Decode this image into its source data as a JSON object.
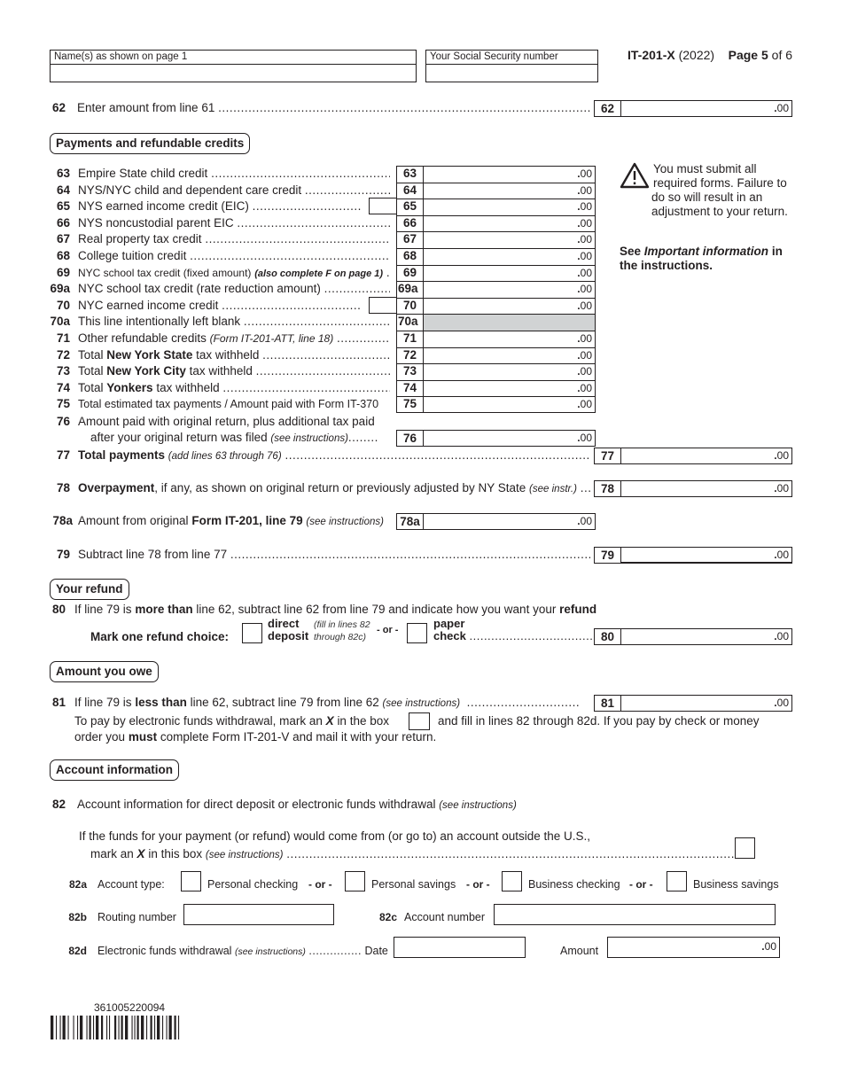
{
  "header": {
    "name_label": "Name(s) as shown on page 1",
    "name_value": "",
    "ssn_label": "Your Social Security number",
    "ssn_value": "",
    "form_id": "IT-201-X",
    "form_year": "(2022)",
    "page_word": "Page",
    "page_num": "5",
    "page_of": "of 6"
  },
  "cents": ".00",
  "line62": {
    "num": "62",
    "text": "Enter amount from line 61",
    "value": ""
  },
  "sections": {
    "payments": "Payments and refundable credits",
    "refund": "Your refund",
    "owe": "Amount you owe",
    "account": "Account information"
  },
  "credits": [
    {
      "num": "63",
      "text": "Empire State child credit",
      "value": "",
      "has_side_box": false,
      "shaded": false
    },
    {
      "num": "64",
      "text": "NYS/NYC child and dependent care credit",
      "value": "",
      "has_side_box": false,
      "shaded": false
    },
    {
      "num": "65",
      "text": "NYS earned income credit (EIC)",
      "value": "",
      "has_side_box": true,
      "shaded": false
    },
    {
      "num": "66",
      "text": "NYS noncustodial parent EIC",
      "value": "",
      "has_side_box": false,
      "shaded": false
    },
    {
      "num": "67",
      "text": "Real property tax credit",
      "value": "",
      "has_side_box": false,
      "shaded": false
    },
    {
      "num": "68",
      "text": "College tuition credit",
      "value": "",
      "has_side_box": false,
      "shaded": false
    },
    {
      "num": "69",
      "text": "NYC school tax credit (fixed amount)",
      "note": "(also complete F on page 1)",
      "value": "",
      "has_side_box": false,
      "shaded": false
    },
    {
      "num": "69a",
      "text": "NYC school tax credit (rate reduction amount)",
      "value": "",
      "has_side_box": false,
      "shaded": false
    },
    {
      "num": "70",
      "text": "NYC earned income credit",
      "value": "",
      "has_side_box": true,
      "shaded": false
    },
    {
      "num": "70a",
      "text": "This line intentionally left blank",
      "value": "",
      "has_side_box": false,
      "shaded": true
    },
    {
      "num": "71",
      "text": "Other refundable credits",
      "note": "(Form IT-201-ATT, line 18)",
      "value": "",
      "has_side_box": false,
      "shaded": false
    },
    {
      "num": "72",
      "text_pre": "Total",
      "text_bold": "New York State",
      "text_post": "tax withheld",
      "value": "",
      "shaded": false
    },
    {
      "num": "73",
      "text_pre": "Total",
      "text_bold": "New York City",
      "text_post": "tax withheld",
      "value": "",
      "shaded": false
    },
    {
      "num": "74",
      "text_pre": "Total",
      "text_bold": "Yonkers",
      "text_post": "tax withheld",
      "value": "",
      "shaded": false
    },
    {
      "num": "75",
      "text": "Total estimated tax payments / Amount paid with Form IT-370",
      "value": "",
      "shaded": false
    }
  ],
  "line76": {
    "num": "76",
    "text1": "Amount paid with original return, plus additional tax paid",
    "text2": "after your original return was filed",
    "note": "(see instructions)",
    "value": ""
  },
  "line77": {
    "num": "77",
    "bold": "Total payments",
    "note": "(add lines 63 through 76)",
    "value": ""
  },
  "line78": {
    "num": "78",
    "bold": "Overpayment",
    "text": ", if any, as shown on original return or previously adjusted by NY State",
    "note": "(see instr.)",
    "value": ""
  },
  "line78a": {
    "num": "78a",
    "text": "Amount from original",
    "bold": "Form IT-201, line 79",
    "note": "(see instructions)",
    "value": ""
  },
  "line79": {
    "num": "79",
    "text": "Subtract line 78 from line 77",
    "value": ""
  },
  "line80": {
    "num": "80",
    "t1": "If line 79 is",
    "b1": "more than",
    "t2": "line 62, subtract line 62 from line 79 and indicate how you want your",
    "b2": "refund",
    "choice_label": "Mark one refund choice:",
    "direct_1": "direct",
    "direct_2": "deposit",
    "direct_note_1": "(fill in lines 82",
    "direct_note_2": "through 82c)",
    "or": "- or -",
    "paper_1": "paper",
    "paper_2": "check",
    "direct_checked": false,
    "paper_checked": false,
    "value": ""
  },
  "line81": {
    "num": "81",
    "t1": "If line 79 is",
    "b1": "less than",
    "t2": "line 62, subtract line 79 from line 62",
    "note": "(see instructions)",
    "value": "",
    "efw_t1": "To pay by electronic funds withdrawal, mark an",
    "efw_x": "X",
    "efw_t2": "in the box",
    "efw_t3": "and fill in lines 82 through 82d. If you pay by check or money",
    "efw_t4": "order you",
    "efw_must": "must",
    "efw_t5": "complete Form IT-201-V and mail it with your return.",
    "efw_checked": false
  },
  "line82": {
    "num": "82",
    "text": "Account information for direct deposit or electronic funds withdrawal",
    "note": "(see instructions)",
    "foreign_t1": "If the funds for your payment (or refund) would come from (or go to) an account outside the U.S.,",
    "foreign_t2": "mark an",
    "foreign_x": "X",
    "foreign_t3": "in this box",
    "foreign_note": "(see instructions)",
    "foreign_checked": false
  },
  "line82a": {
    "num": "82a",
    "label": "Account type:",
    "or": "- or -",
    "options": [
      "Personal checking",
      "Personal savings",
      "Business checking",
      "Business savings"
    ]
  },
  "line82b": {
    "num": "82b",
    "label": "Routing number",
    "value": ""
  },
  "line82c": {
    "num": "82c",
    "label": "Account number",
    "value": ""
  },
  "line82d": {
    "num": "82d",
    "label": "Electronic funds withdrawal",
    "note": "(see instructions)",
    "date_label": "Date",
    "date_value": "",
    "amount_label": "Amount",
    "amount_value": ""
  },
  "warning": {
    "icon": "warning-triangle-icon",
    "text": "You must submit all required forms. Failure to do so will result in an adjustment to your return.",
    "see_pre": "See",
    "see_italic": "Important information",
    "see_post": "in the instructions."
  },
  "barcode": {
    "number": "361005220094"
  }
}
